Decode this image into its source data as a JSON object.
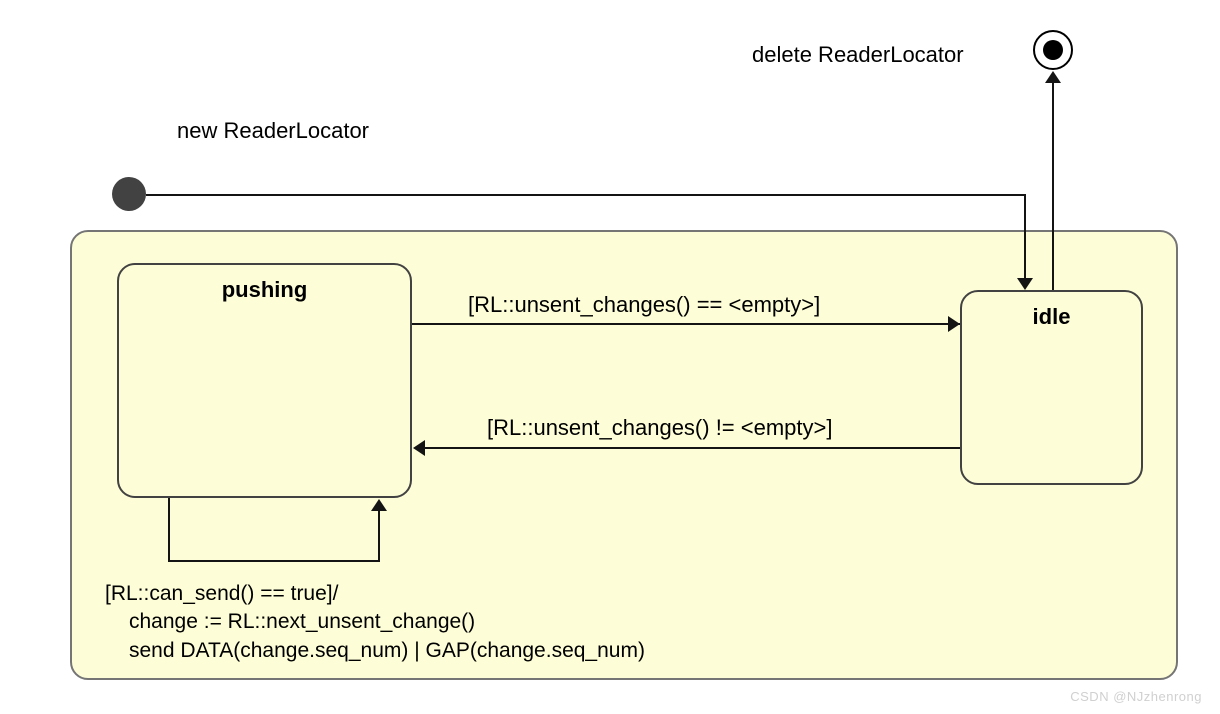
{
  "initial_label": "new ReaderLocator",
  "final_label": "delete ReaderLocator",
  "state_pushing": "pushing",
  "state_idle": "idle",
  "trans_to_idle": "[RL::unsent_changes() == <empty>]",
  "trans_to_pushing": "[RL::unsent_changes() != <empty>]",
  "self_guard": "[RL::can_send() == true]/",
  "self_action1": "change := RL::next_unsent_change()",
  "self_action2": "send DATA(change.seq_num) | GAP(change.seq_num)",
  "watermark": "CSDN @NJzhenrong"
}
